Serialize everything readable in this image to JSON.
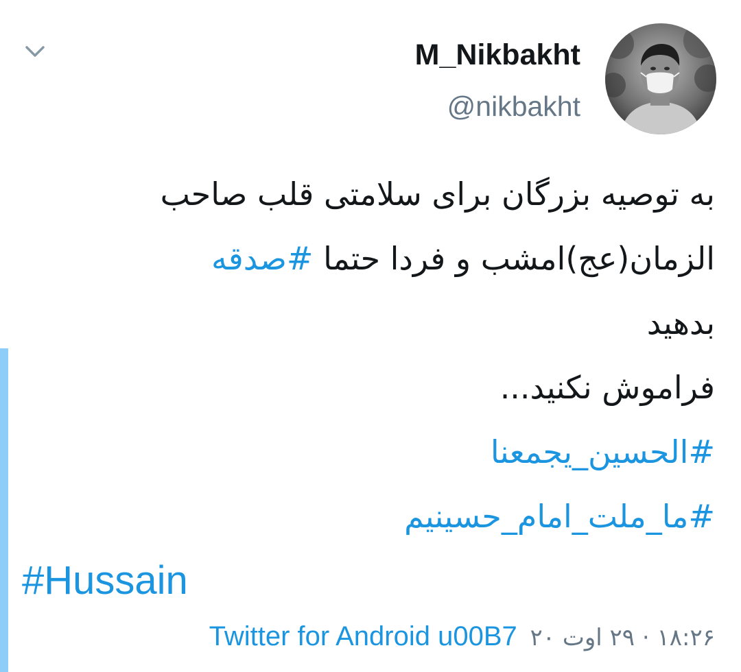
{
  "colors": {
    "link_blue": "#1b95e0",
    "secondary_gray": "#657786",
    "accent_bar": "#8ecdf7",
    "text_dark": "#14171a"
  },
  "header": {
    "menu_icon": "chevron-down-icon",
    "avatar_icon": "profile-photo",
    "display_name": "M_Nikbakht",
    "handle": "@nikbakht"
  },
  "tweet": {
    "line1": "به توصیه بزرگان برای سلامتی قلب صاحب",
    "line2_text": "الزمان(عج)امشب و فردا حتما ",
    "line2_hashtag": "#صدقه",
    "line3": "بدهید",
    "line4": "فراموش نکنید...",
    "hashtag1": "#الحسین_یجمعنا",
    "hashtag2": "#ما_ملت_امام_حسینیم",
    "hashtag3": "#Hussain"
  },
  "meta": {
    "timestamp": "۱۸:۲۶ · ۲۹ اوت ۲۰",
    "source": "Twitter for Android u00B7"
  }
}
